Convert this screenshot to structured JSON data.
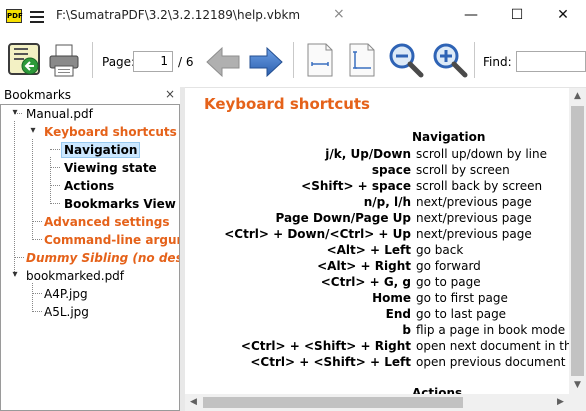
{
  "window": {
    "app_icon_text": "PDF",
    "tab_title": "F:\\SumatraPDF\\3.2\\3.2.12189\\help.vbkm",
    "tab_close": "×",
    "minimize": "—",
    "maximize": "☐",
    "close": "✕"
  },
  "toolbar": {
    "page_label": "Page:",
    "page_value": "1",
    "page_total": "/ 6",
    "find_label": "Find:",
    "find_value": ""
  },
  "bookmarks": {
    "title": "Bookmarks",
    "close": "×",
    "items": [
      {
        "label": "Manual.pdf",
        "expander": "▾",
        "color": "#000000"
      },
      {
        "label": "Keyboard shortcuts",
        "expander": "▾",
        "color": "#e5621a"
      },
      {
        "label": "Navigation",
        "color": "#000000"
      },
      {
        "label": "Viewing state",
        "color": "#000000"
      },
      {
        "label": "Actions",
        "color": "#000000"
      },
      {
        "label": "Bookmarks View",
        "color": "#000000"
      },
      {
        "label": "Advanced settings",
        "color": "#e5621a"
      },
      {
        "label": "Command-line argumen",
        "color": "#e5621a"
      },
      {
        "label": "Dummy Sibling (no destinat",
        "color": "#e5621a"
      },
      {
        "label": "bookmarked.pdf",
        "expander": "▾",
        "color": "#000000"
      },
      {
        "label": "A4P.jpg",
        "color": "#000000"
      },
      {
        "label": "A5L.jpg",
        "color": "#000000"
      }
    ]
  },
  "document": {
    "heading": "Keyboard shortcuts",
    "section": "Navigation",
    "next_section": "Actions",
    "shortcuts": [
      {
        "key": "j/k, Up/Down",
        "desc": "scroll up/down by line"
      },
      {
        "key": "space",
        "desc": "scroll by screen"
      },
      {
        "key": "<Shift> + space",
        "desc": "scroll back by screen"
      },
      {
        "key": "n/p, l/h",
        "desc": "next/previous page"
      },
      {
        "key": "Page Down/Page Up",
        "desc": "next/previous page"
      },
      {
        "key": "<Ctrl> + Down/<Ctrl> + Up",
        "desc": "next/previous page"
      },
      {
        "key": "<Alt> + Left",
        "desc": "go back"
      },
      {
        "key": "<Alt> + Right",
        "desc": "go forward"
      },
      {
        "key": "<Ctrl> + G, g",
        "desc": "go to page"
      },
      {
        "key": "Home",
        "desc": "go to first page"
      },
      {
        "key": "End",
        "desc": "go to last page"
      },
      {
        "key": "b",
        "desc": "flip a page in book mode"
      },
      {
        "key": "<Ctrl> + <Shift> + Right",
        "desc": "open next document in th"
      },
      {
        "key": "<Ctrl> + <Shift> + Left",
        "desc": "open previous document"
      }
    ]
  },
  "colors": {
    "accent_orange": "#e5621a",
    "selection": "#cce8ff",
    "arrow_blue": "#3a6fc0"
  },
  "icons": [
    "open-file-icon",
    "print-icon",
    "back-arrow-icon",
    "forward-arrow-icon",
    "fit-page-icon",
    "fit-width-icon",
    "zoom-out-icon",
    "zoom-in-icon"
  ]
}
